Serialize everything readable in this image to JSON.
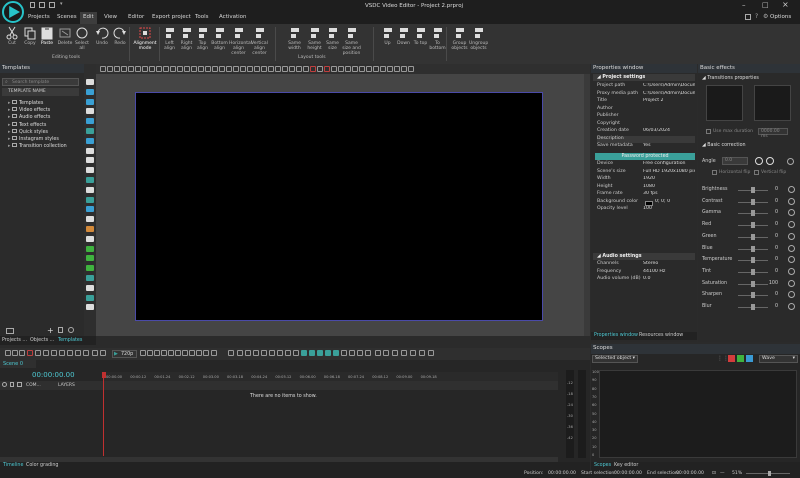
{
  "window": {
    "title": "VSDC Video Editor - Project 2.prproj"
  },
  "menu": [
    "Projects",
    "Scenes",
    "Edit",
    "View",
    "Editor",
    "Export project",
    "Tools",
    "Activation"
  ],
  "menu_right": {
    "options": "Options"
  },
  "ribbon": {
    "editing": [
      {
        "label": "Cut",
        "icon": "scissors-icon"
      },
      {
        "label": "Copy",
        "icon": "copy-icon"
      },
      {
        "label": "Paste",
        "icon": "paste-icon"
      },
      {
        "label": "Delete",
        "icon": "delete-icon"
      },
      {
        "label": "Select all",
        "icon": "select-all-icon"
      },
      {
        "label": "Undo",
        "icon": "undo-icon"
      },
      {
        "label": "Redo",
        "icon": "redo-icon"
      }
    ],
    "editing_group": "Editing tools",
    "alignment_mode": "Alignment mode",
    "layout": [
      {
        "label": "Left align"
      },
      {
        "label": "Right align"
      },
      {
        "label": "Top align"
      },
      {
        "label": "Bottom align"
      },
      {
        "label": "Horizontal align center"
      },
      {
        "label": "Vertical align center"
      },
      {
        "label": "Same width"
      },
      {
        "label": "Same height"
      },
      {
        "label": "Same size"
      },
      {
        "label": "Same size and position"
      },
      {
        "label": "Up"
      },
      {
        "label": "Down"
      },
      {
        "label": "To top"
      },
      {
        "label": "To bottom"
      },
      {
        "label": "Group objects"
      },
      {
        "label": "Ungroup objects"
      }
    ],
    "layout_group": "Layout tools"
  },
  "templates": {
    "title": "Templates",
    "search_placeholder": "Search template",
    "column": "TEMPLATE NAME",
    "items": [
      "Templates",
      "Video effects",
      "Audio effects",
      "Text effects",
      "Quick styles",
      "Instagram styles",
      "Transition collection"
    ],
    "tabs": [
      "Projects ...",
      "Objects ...",
      "Templates"
    ]
  },
  "properties": {
    "title": "Properties window",
    "section1": "Project settings",
    "rows": [
      {
        "k": "Project path",
        "v": "C:\\Users\\Admin\\Docum"
      },
      {
        "k": "Proxy media path",
        "v": "C:\\Users\\Admin\\Docum"
      },
      {
        "k": "Title",
        "v": "Project 2"
      },
      {
        "k": "Author",
        "v": ""
      },
      {
        "k": "Publisher",
        "v": ""
      },
      {
        "k": "Copyright",
        "v": ""
      },
      {
        "k": "Creation date",
        "v": "06/03/2024"
      },
      {
        "k": "Description",
        "v": ""
      },
      {
        "k": "Save metadata",
        "v": "Yes"
      }
    ],
    "password_btn": "Password protected",
    "rows2": [
      {
        "k": "Device",
        "v": "Free configuration"
      },
      {
        "k": "Scene's size",
        "v": "Full HD 1920x1080 pixe"
      },
      {
        "k": "Width",
        "v": "1920"
      },
      {
        "k": "Height",
        "v": "1080"
      },
      {
        "k": "Frame rate",
        "v": "30 fps"
      },
      {
        "k": "Background color",
        "v": "0; 0; 0"
      },
      {
        "k": "Opacity level",
        "v": "100"
      }
    ],
    "section2": "Audio settings",
    "rows3": [
      {
        "k": "Channels",
        "v": "Stereo"
      },
      {
        "k": "Frequency",
        "v": "44100 Hz"
      },
      {
        "k": "Audio volume (dB)",
        "v": "0.0"
      }
    ],
    "tabs": [
      "Properties window",
      "Resources window"
    ]
  },
  "basic": {
    "title": "Basic effects",
    "transitions": "Transitions properties",
    "use_max": "Use max duration",
    "duration": "0000.00 ms",
    "basic_correction": "Basic correction",
    "angle_label": "Angle",
    "angle_value": "0.0",
    "flip_h": "Horizontal flip",
    "flip_v": "Vertical flip",
    "sliders": [
      {
        "k": "Brightness",
        "v": "0",
        "pos": 0.5
      },
      {
        "k": "Contrast",
        "v": "0",
        "pos": 0.5
      },
      {
        "k": "Gamma",
        "v": "0",
        "pos": 0.5
      },
      {
        "k": "Red",
        "v": "0",
        "pos": 0.5
      },
      {
        "k": "Green",
        "v": "0",
        "pos": 0.5
      },
      {
        "k": "Blue",
        "v": "0",
        "pos": 0.5
      },
      {
        "k": "Temperature",
        "v": "0",
        "pos": 0.5
      },
      {
        "k": "Tint",
        "v": "0",
        "pos": 0.5
      },
      {
        "k": "Saturation",
        "v": "100",
        "pos": 0.5
      },
      {
        "k": "Sharpen",
        "v": "0",
        "pos": 0.5
      },
      {
        "k": "Blur",
        "v": "0",
        "pos": 0.5
      }
    ]
  },
  "timeline_bar": {
    "resolution": "720p"
  },
  "timeline": {
    "scene": "Scene 0",
    "time": "00:00:00.00",
    "com": "COM...",
    "layers": "LAYERS",
    "ticks": [
      "00:00.00",
      "00:00.12",
      "00:01.24",
      "00:02.12",
      "00:03.00",
      "00:03.18",
      "00:04.24",
      "00:05.12",
      "00:06.00",
      "00:06.18",
      "00:07.24",
      "00:08.12",
      "00:09.00",
      "00:09.18"
    ],
    "empty": "There are no items to show.",
    "tabs": [
      "Timeline",
      "Color grading"
    ]
  },
  "scopes": {
    "title": "Scopes",
    "select": "Selected object",
    "wave": "Wave",
    "labels": [
      "100",
      "90",
      "80",
      "70",
      "60",
      "50",
      "40",
      "30",
      "20",
      "10",
      "0"
    ],
    "tabs": [
      "Scopes",
      "Key editor"
    ],
    "audio_labels": [
      "-12",
      "-18",
      "-24",
      "-30",
      "-36",
      "-42"
    ]
  },
  "status": {
    "position_label": "Position:",
    "position": "00:00:00.00",
    "start_label": "Start selection:",
    "start": "00:00:00.00",
    "end_label": "End selection:",
    "end": "00:00:00.00",
    "zoom": "51%"
  }
}
